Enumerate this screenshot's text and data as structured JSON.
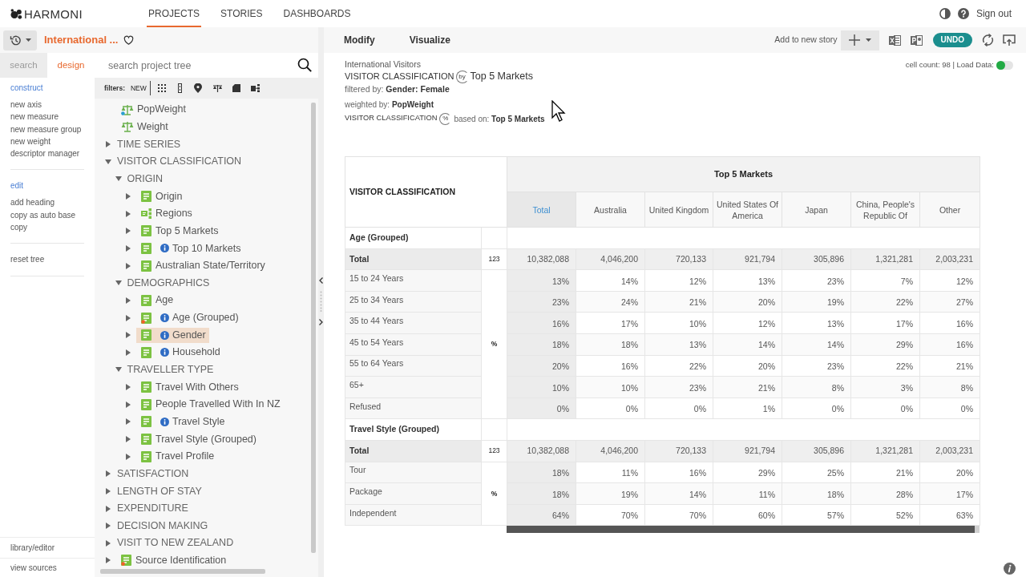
{
  "top_nav": {
    "logo": "HARMONI",
    "tabs": [
      {
        "label": "PROJECTS",
        "selected": true
      },
      {
        "label": "STORIES",
        "selected": false
      },
      {
        "label": "DASHBOARDS",
        "selected": false
      }
    ],
    "sign_out": "Sign out"
  },
  "project_bar": {
    "title": "International ..."
  },
  "left_tabs": [
    {
      "label": "search",
      "selected": false
    },
    {
      "label": "design",
      "selected": true
    }
  ],
  "design_menu": {
    "sections": [
      {
        "heading": "construct",
        "items": [
          "new axis",
          "new measure",
          "new measure group",
          "new weight",
          "descriptor manager"
        ]
      },
      {
        "heading": "edit",
        "items": [
          "add heading",
          "copy as auto base",
          "copy"
        ]
      },
      {
        "items": [
          "reset tree"
        ]
      }
    ],
    "footer": [
      "library/editor",
      "view sources"
    ]
  },
  "tree_search": {
    "placeholder": "search project tree"
  },
  "filters": {
    "label": "filters:",
    "new": "NEW"
  },
  "tree": [
    {
      "kind": "weight",
      "label": "PopWeight",
      "active": true,
      "selected": false
    },
    {
      "kind": "weight",
      "label": "Weight",
      "active": false,
      "selected": false
    },
    {
      "kind": "folder",
      "label": "TIME SERIES",
      "expanded": false,
      "selected": false
    },
    {
      "kind": "folder",
      "label": "VISITOR CLASSIFICATION",
      "expanded": true,
      "selected": false,
      "children": [
        {
          "kind": "folder",
          "label": "ORIGIN",
          "expanded": true,
          "selected": false,
          "children": [
            {
              "kind": "variable",
              "label": "Origin",
              "expanded": false,
              "info": false,
              "flagged": false,
              "selected": false
            },
            {
              "kind": "hierarchy",
              "label": "Regions",
              "expanded": false,
              "info": false,
              "flagged": false,
              "selected": false
            },
            {
              "kind": "variable",
              "label": "Top 5 Markets",
              "expanded": false,
              "info": false,
              "flagged": false,
              "selected": false
            },
            {
              "kind": "variable",
              "label": "Top 10 Markets",
              "expanded": false,
              "info": true,
              "flagged": false,
              "selected": false
            },
            {
              "kind": "variable",
              "label": "Australian State/Territory",
              "expanded": false,
              "info": false,
              "flagged": false,
              "selected": false
            }
          ]
        },
        {
          "kind": "folder",
          "label": "DEMOGRAPHICS",
          "expanded": true,
          "selected": false,
          "children": [
            {
              "kind": "variable",
              "label": "Age",
              "expanded": false,
              "info": false,
              "flagged": false,
              "selected": false
            },
            {
              "kind": "variable",
              "label": "Age (Grouped)",
              "expanded": false,
              "info": true,
              "flagged": true,
              "selected": false
            },
            {
              "kind": "variable",
              "label": "Gender",
              "expanded": false,
              "info": true,
              "flagged": false,
              "selected": true
            },
            {
              "kind": "variable",
              "label": "Household",
              "expanded": false,
              "info": true,
              "flagged": false,
              "selected": false
            }
          ]
        },
        {
          "kind": "folder",
          "label": "TRAVELLER TYPE",
          "expanded": true,
          "selected": false,
          "children": [
            {
              "kind": "variable",
              "label": "Travel With Others",
              "expanded": false,
              "info": false,
              "flagged": false,
              "selected": false
            },
            {
              "kind": "variable",
              "label": "People Travelled With In NZ",
              "expanded": false,
              "info": false,
              "flagged": false,
              "selected": false
            },
            {
              "kind": "variable",
              "label": "Travel Style",
              "expanded": false,
              "info": true,
              "flagged": false,
              "selected": false
            },
            {
              "kind": "variable",
              "label": "Travel Style (Grouped)",
              "expanded": false,
              "info": false,
              "flagged": false,
              "selected": false
            },
            {
              "kind": "variable",
              "label": "Travel Profile",
              "expanded": false,
              "info": false,
              "flagged": false,
              "selected": false
            }
          ]
        }
      ]
    },
    {
      "kind": "folder",
      "label": "SATISFACTION",
      "expanded": false,
      "selected": false
    },
    {
      "kind": "folder",
      "label": "LENGTH OF STAY",
      "expanded": false,
      "selected": false
    },
    {
      "kind": "folder",
      "label": "EXPENDITURE",
      "expanded": false,
      "selected": false
    },
    {
      "kind": "folder",
      "label": "DECISION MAKING",
      "expanded": false,
      "selected": false
    },
    {
      "kind": "folder",
      "label": "VISIT TO NEW ZEALAND",
      "expanded": false,
      "selected": false
    },
    {
      "kind": "variable",
      "label": "Source Identification",
      "expanded": false,
      "info": false,
      "flagged": true,
      "selected": false
    }
  ],
  "toolbar": {
    "actions": [
      "Modify",
      "Visualize"
    ],
    "add_story": "Add to new story",
    "undo": "UNDO"
  },
  "report": {
    "project": "International Visitors",
    "title_rows": "VISITOR CLASSIFICATION",
    "title_connector": "by",
    "title_columns": "Top 5 Markets",
    "filter": "filtered by: **Gender: Female**",
    "weight": "weighted by: **PopWeight**",
    "base_variable": "VISITOR CLASSIFICATION",
    "base_connector": "%",
    "base": "based on: **Top 5 Markets**",
    "cell_count": "cell count: 98 | Load Data:",
    "load_data": true
  },
  "table": {
    "corner": "VISITOR CLASSIFICATION",
    "banner": "Top 5 Markets",
    "columns": [
      {
        "label": "Total",
        "kind": "total"
      },
      {
        "label": "Australia",
        "kind": "category"
      },
      {
        "label": "United Kingdom",
        "kind": "category"
      },
      {
        "label": "United States Of America",
        "kind": "category"
      },
      {
        "label": "Japan",
        "kind": "category"
      },
      {
        "label": "China, People's Republic Of",
        "kind": "category"
      },
      {
        "label": "Other",
        "kind": "category"
      }
    ],
    "sections": [
      {
        "heading": "Age (Grouped)",
        "total": {
          "label": "Total",
          "unit": "123",
          "values": [
            "10,382,088",
            "4,046,200",
            "720,133",
            "921,794",
            "305,896",
            "1,321,281",
            "2,003,231"
          ]
        },
        "unit": "%",
        "rows": [
          {
            "label": "15 to 24 Years",
            "values": [
              "13%",
              "14%",
              "12%",
              "13%",
              "23%",
              "7%",
              "12%"
            ]
          },
          {
            "label": "25 to 34 Years",
            "values": [
              "23%",
              "24%",
              "21%",
              "20%",
              "19%",
              "22%",
              "27%"
            ]
          },
          {
            "label": "35 to 44 Years",
            "values": [
              "16%",
              "17%",
              "10%",
              "12%",
              "13%",
              "17%",
              "16%"
            ]
          },
          {
            "label": "45 to 54 Years",
            "values": [
              "18%",
              "18%",
              "13%",
              "14%",
              "14%",
              "29%",
              "16%"
            ]
          },
          {
            "label": "55 to 64 Years",
            "values": [
              "20%",
              "16%",
              "22%",
              "20%",
              "23%",
              "22%",
              "21%"
            ]
          },
          {
            "label": "65+",
            "values": [
              "10%",
              "10%",
              "23%",
              "21%",
              "8%",
              "3%",
              "8%"
            ]
          },
          {
            "label": "Refused",
            "values": [
              "0%",
              "0%",
              "0%",
              "1%",
              "0%",
              "0%",
              "0%"
            ]
          }
        ]
      },
      {
        "heading": "Travel Style (Grouped)",
        "total": {
          "label": "Total",
          "unit": "123",
          "values": [
            "10,382,088",
            "4,046,200",
            "720,133",
            "921,794",
            "305,896",
            "1,321,281",
            "2,003,231"
          ]
        },
        "unit": "%",
        "rows": [
          {
            "label": "Tour",
            "values": [
              "18%",
              "11%",
              "16%",
              "29%",
              "25%",
              "21%",
              "20%"
            ]
          },
          {
            "label": "Package",
            "values": [
              "18%",
              "19%",
              "14%",
              "11%",
              "18%",
              "28%",
              "17%"
            ]
          },
          {
            "label": "Independent",
            "values": [
              "64%",
              "70%",
              "70%",
              "60%",
              "57%",
              "52%",
              "63%"
            ]
          }
        ]
      }
    ]
  }
}
